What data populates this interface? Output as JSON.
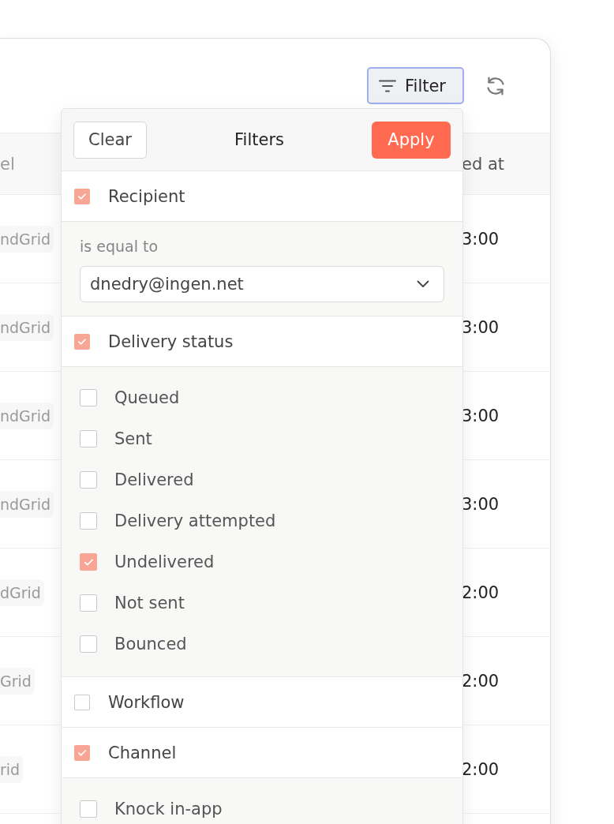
{
  "toolbar": {
    "filter_button": {
      "label": "Filter",
      "focused": true
    }
  },
  "table": {
    "columns": [
      "el",
      "ed at"
    ],
    "rows": [
      {
        "channel": "ndGrid",
        "time": "3:00"
      },
      {
        "channel": "ndGrid",
        "time": "3:00"
      },
      {
        "channel": "ndGrid",
        "time": "3:00"
      },
      {
        "channel": "ndGrid",
        "time": "3:00"
      },
      {
        "channel": "dGrid",
        "time": "2:00"
      },
      {
        "channel": "Grid",
        "time": "2:00"
      },
      {
        "channel": "rid",
        "time": "2:00"
      }
    ]
  },
  "filter_panel": {
    "clear_label": "Clear",
    "title": "Filters",
    "apply_label": "Apply",
    "sections": [
      {
        "label": "Recipient",
        "checked": true,
        "detail": {
          "kind": "select",
          "operator": "is equal to",
          "value": "dnedry@ingen.net"
        }
      },
      {
        "label": "Delivery status",
        "checked": true,
        "detail": {
          "kind": "options",
          "options": [
            {
              "label": "Queued",
              "checked": false
            },
            {
              "label": "Sent",
              "checked": false
            },
            {
              "label": "Delivered",
              "checked": false
            },
            {
              "label": "Delivery attempted",
              "checked": false
            },
            {
              "label": "Undelivered",
              "checked": true
            },
            {
              "label": "Not sent",
              "checked": false
            },
            {
              "label": "Bounced",
              "checked": false
            }
          ]
        }
      },
      {
        "label": "Workflow",
        "checked": false
      },
      {
        "label": "Channel",
        "checked": true,
        "detail": {
          "kind": "options",
          "options": [
            {
              "label": "Knock in-app",
              "checked": false
            }
          ]
        }
      }
    ]
  }
}
